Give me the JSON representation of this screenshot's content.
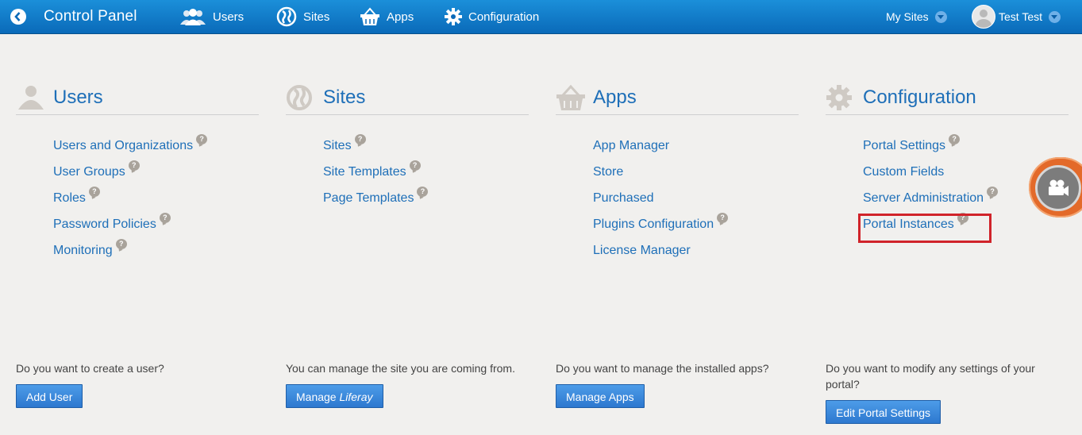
{
  "topbar": {
    "title": "Control Panel",
    "nav": [
      {
        "label": "Users",
        "icon": "users-icon"
      },
      {
        "label": "Sites",
        "icon": "globe-icon"
      },
      {
        "label": "Apps",
        "icon": "basket-icon"
      },
      {
        "label": "Configuration",
        "icon": "gear-icon"
      }
    ],
    "my_sites": "My Sites",
    "user_name": "Test Test"
  },
  "columns": [
    {
      "title": "Users",
      "icon": "users-icon",
      "links": [
        "Users and Organizations",
        "User Groups",
        "Roles",
        "Password Policies",
        "Monitoring"
      ],
      "prompt": "Do you want to create a user?",
      "button": "Add User"
    },
    {
      "title": "Sites",
      "icon": "globe-icon",
      "links": [
        "Sites",
        "Site Templates",
        "Page Templates"
      ],
      "prompt": "You can manage the site you are coming from.",
      "button_prefix": "Manage",
      "button_em": "Liferay"
    },
    {
      "title": "Apps",
      "icon": "basket-icon",
      "links": [
        "App Manager",
        "Store",
        "Purchased",
        "Plugins Configuration",
        "License Manager"
      ],
      "prompt": "Do you want to manage the installed apps?",
      "button": "Manage Apps"
    },
    {
      "title": "Configuration",
      "icon": "gear-icon",
      "links": [
        "Portal Settings",
        "Custom Fields",
        "Server Administration",
        "Portal Instances"
      ],
      "prompt": "Do you want to modify any settings of your portal?",
      "button": "Edit Portal Settings"
    }
  ],
  "help_badge": "?",
  "colors": {
    "topbar": "#0a6ab9",
    "link": "#1e6fb8",
    "highlight": "#d0232a",
    "button": "#2d78cf"
  }
}
